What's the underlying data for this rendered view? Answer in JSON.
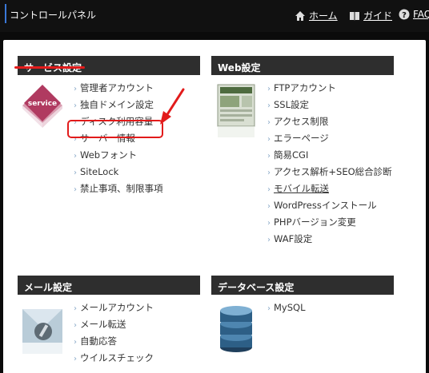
{
  "topbar": {
    "title": "コントロールパネル",
    "nav": [
      {
        "label": "ホーム",
        "icon": "home-icon"
      },
      {
        "label": "ガイド",
        "icon": "book-icon"
      },
      {
        "label": "FAQ",
        "icon": "help-icon"
      }
    ]
  },
  "sections": {
    "service": {
      "title": "サービス設定",
      "icon_label": "service",
      "items": [
        "管理者アカウント",
        "独自ドメイン設定",
        "ディスク利用容量",
        "サーバー情報",
        "Webフォント",
        "SiteLock",
        "禁止事項、制限事項"
      ]
    },
    "web": {
      "title": "Web設定",
      "items": [
        "FTPアカウント",
        "SSL設定",
        "アクセス制限",
        "エラーページ",
        "簡易CGI",
        "アクセス解析+SEO総合診断",
        "モバイル転送",
        "WordPressインストール",
        "PHPバージョン変更",
        "WAF設定"
      ]
    },
    "mail": {
      "title": "メール設定",
      "items": [
        "メールアカウント",
        "メール転送",
        "自動応答",
        "ウイルスチェック"
      ]
    },
    "db": {
      "title": "データベース設定",
      "items": [
        "MySQL"
      ]
    }
  },
  "colors": {
    "annotation": "#e21b1b",
    "header_bg": "#2e2e2e",
    "accent": "#3a78d8"
  }
}
